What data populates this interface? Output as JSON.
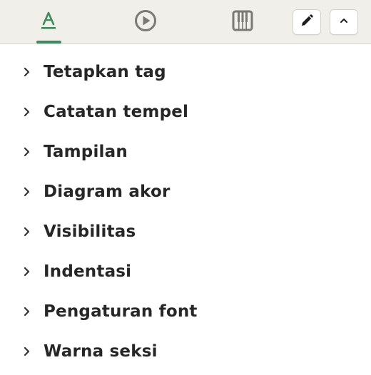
{
  "toolbar": {
    "tabs": [
      {
        "name": "text-format-tab",
        "icon": "text-format-icon",
        "active": true
      },
      {
        "name": "play-tab",
        "icon": "play-circle-icon",
        "active": false
      },
      {
        "name": "piano-tab",
        "icon": "piano-keys-icon",
        "active": false
      }
    ],
    "buttons": [
      {
        "name": "edit-button",
        "icon": "pencil-icon"
      },
      {
        "name": "collapse-button",
        "icon": "chevron-up-icon"
      }
    ],
    "active_color": "#3f8a5f",
    "icon_color": "#7a7a72"
  },
  "menu": {
    "items": [
      {
        "label": "Tetapkan tag"
      },
      {
        "label": "Catatan tempel"
      },
      {
        "label": "Tampilan"
      },
      {
        "label": "Diagram akor"
      },
      {
        "label": "Visibilitas"
      },
      {
        "label": "Indentasi"
      },
      {
        "label": "Pengaturan font"
      },
      {
        "label": "Warna seksi"
      }
    ]
  }
}
